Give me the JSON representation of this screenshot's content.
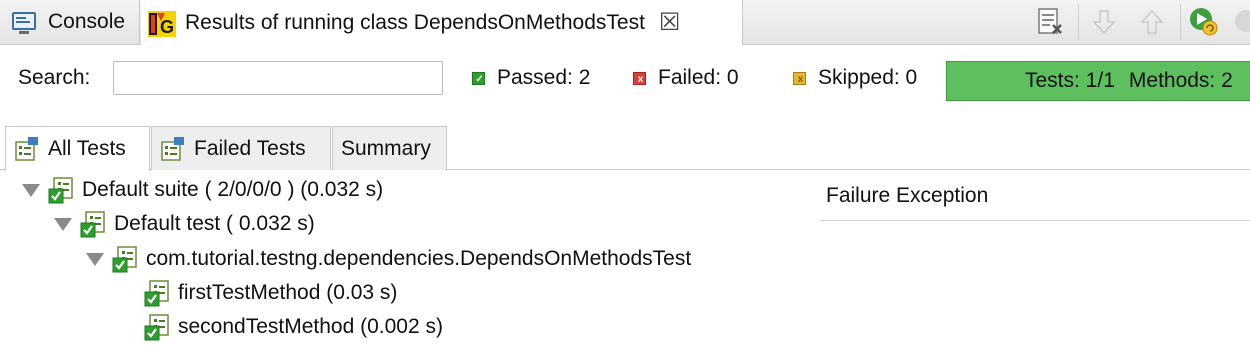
{
  "tabs": {
    "console_label": "Console",
    "results_label": "Results of running class DependsOnMethodsTest"
  },
  "search": {
    "label": "Search:",
    "value": ""
  },
  "counters": {
    "passed": "Passed: 2",
    "failed": "Failed: 0",
    "skipped": "Skipped: 0"
  },
  "progress": {
    "tests": "Tests: 1/1",
    "methods": "Methods: 2",
    "fraction": 1.0,
    "color": "#5dbf5d"
  },
  "subtabs": {
    "all_tests": "All Tests",
    "failed_tests": "Failed Tests",
    "summary": "Summary"
  },
  "tree": {
    "suite": "Default suite ( 2/0/0/0 ) (0.032 s)",
    "test": "Default test ( 0.032 s)",
    "class": "com.tutorial.testng.dependencies.DependsOnMethodsTest",
    "methods": [
      "firstTestMethod  (0.03 s)",
      "secondTestMethod  (0.002 s)"
    ]
  },
  "details": {
    "failure_title": "Failure Exception"
  },
  "colors": {
    "pass": "#2e9e2e",
    "fail": "#d8403a",
    "skip": "#d9a628"
  }
}
